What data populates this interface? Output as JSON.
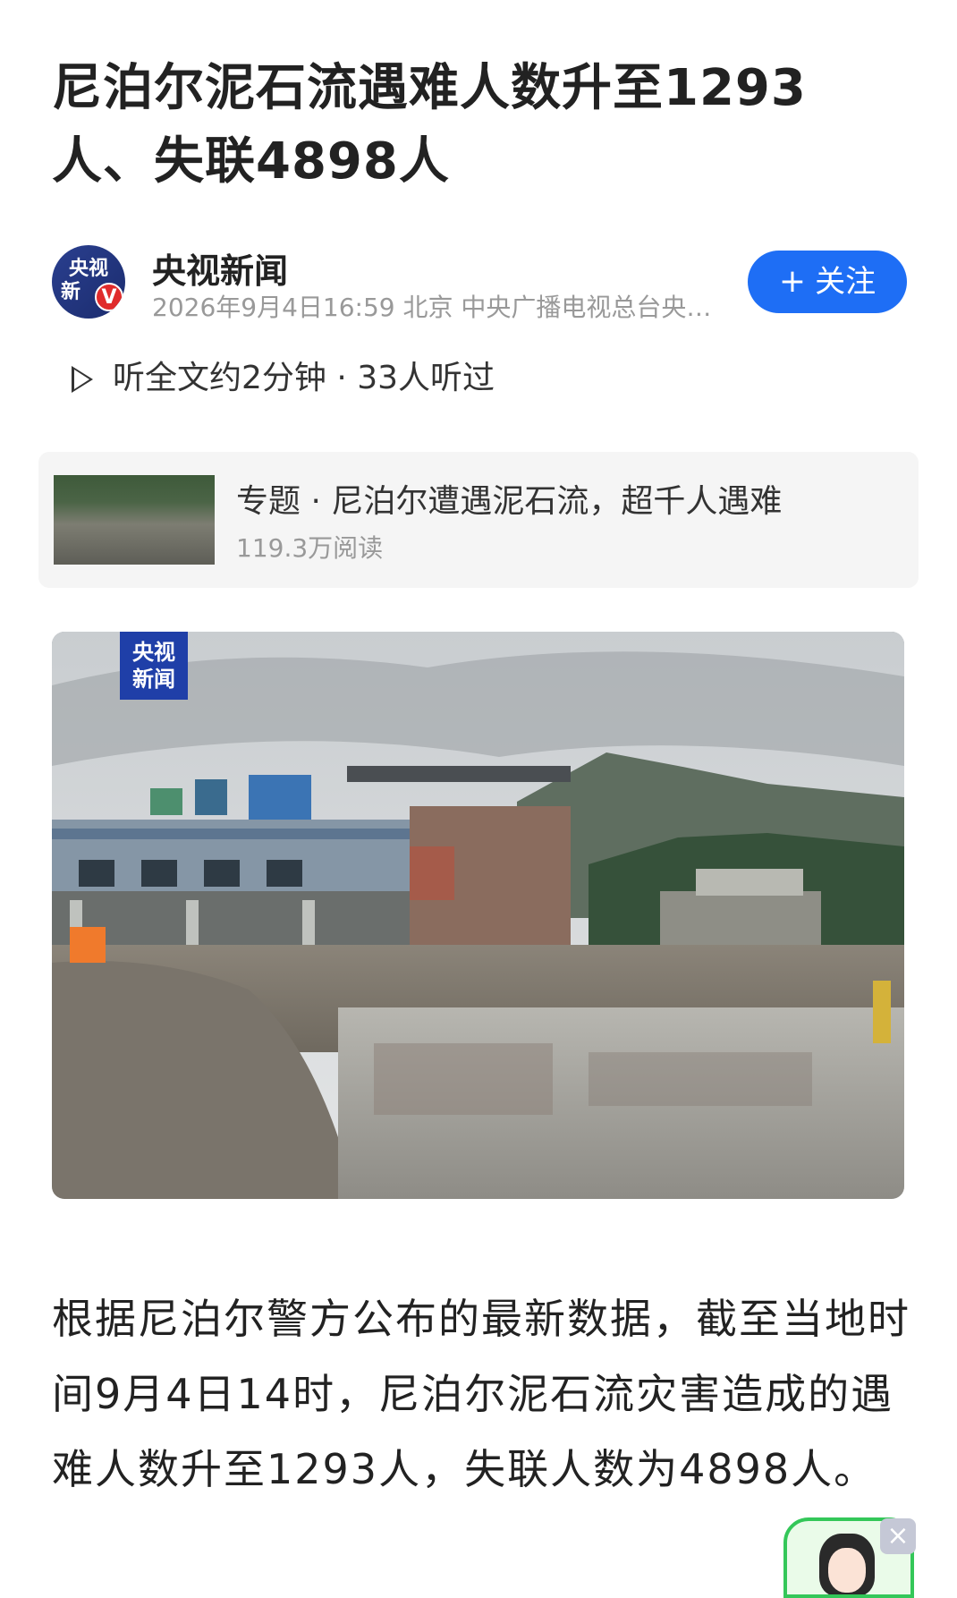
{
  "article": {
    "title": "尼泊尔泥石流遇难人数升至1293人、失联4898人"
  },
  "author": {
    "avatar_text_line1": "央视",
    "avatar_text_line2": "新",
    "avatar_badge": "V",
    "name": "央视新闻",
    "meta": "2026年9月4日16:59 北京 中央广播电视总台央…",
    "follow_label": "关注",
    "follow_plus": "+"
  },
  "listen": {
    "label": "听全文约2分钟 · 33人听过"
  },
  "topic": {
    "title": "专题 · 尼泊尔遭遇泥石流，超千人遇难",
    "reads": "119.3万阅读"
  },
  "hero": {
    "logo_line1": "央视",
    "logo_line2": "新闻"
  },
  "body": {
    "paragraph": "根据尼泊尔警方公布的最新数据，截至当地时间9月4日14时，尼泊尔泥石流灾害造成的遇难人数升至1293人，失联人数为4898人。"
  },
  "widget": {
    "close": "×"
  },
  "colors": {
    "accent": "#1e6ef5",
    "meta_gray": "#999999",
    "card_bg": "#f5f5f5",
    "widget_green": "#34c759",
    "badge_red": "#e02b2b"
  }
}
